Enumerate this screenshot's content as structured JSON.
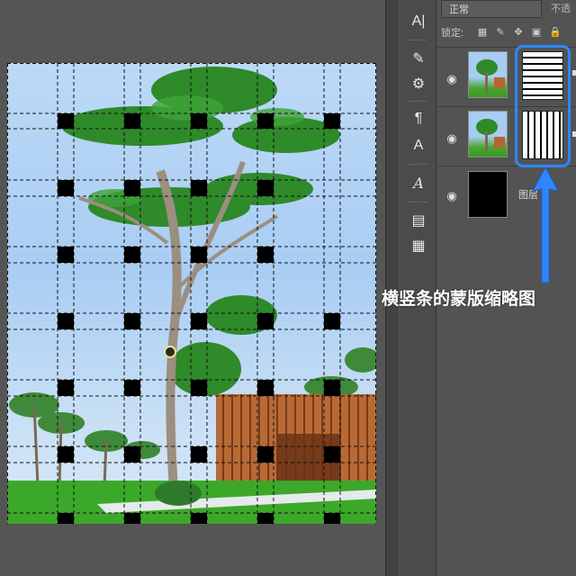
{
  "canvas": {
    "description_icon": "photo-canvas"
  },
  "tools": [
    {
      "icon": "text-vertical-icon",
      "glyph": "A|"
    },
    {
      "icon": "brush-icon",
      "glyph": "✎"
    },
    {
      "icon": "brush-adjust-icon",
      "glyph": "⚙"
    },
    {
      "icon": "paragraph-icon",
      "glyph": "¶"
    },
    {
      "icon": "char-style-icon",
      "glyph": "A"
    },
    {
      "icon": "glyph-icon",
      "glyph": "𝐴"
    },
    {
      "icon": "properties-icon",
      "glyph": "▤"
    },
    {
      "icon": "notes-icon",
      "glyph": "▦"
    }
  ],
  "layers_panel": {
    "blend_mode": "正常",
    "opacity_label": "不透",
    "lock_label": "锁定:",
    "lock_icons": [
      "checker-lock-icon",
      "brush-lock-icon",
      "move-lock-icon",
      "artboard-lock-icon",
      "lock-icon"
    ],
    "layers": [
      {
        "name": "",
        "thumb": "photo",
        "mask": "horizontal-stripes",
        "visible": true
      },
      {
        "name": "",
        "thumb": "photo",
        "mask": "vertical-stripes",
        "visible": true
      },
      {
        "name": "图层",
        "thumb": "black",
        "mask": "",
        "visible": true
      }
    ]
  },
  "annotation": {
    "text": "横竖条的蒙版缩略图",
    "color": "#ffffff",
    "highlight_color": "#2f86ff"
  }
}
